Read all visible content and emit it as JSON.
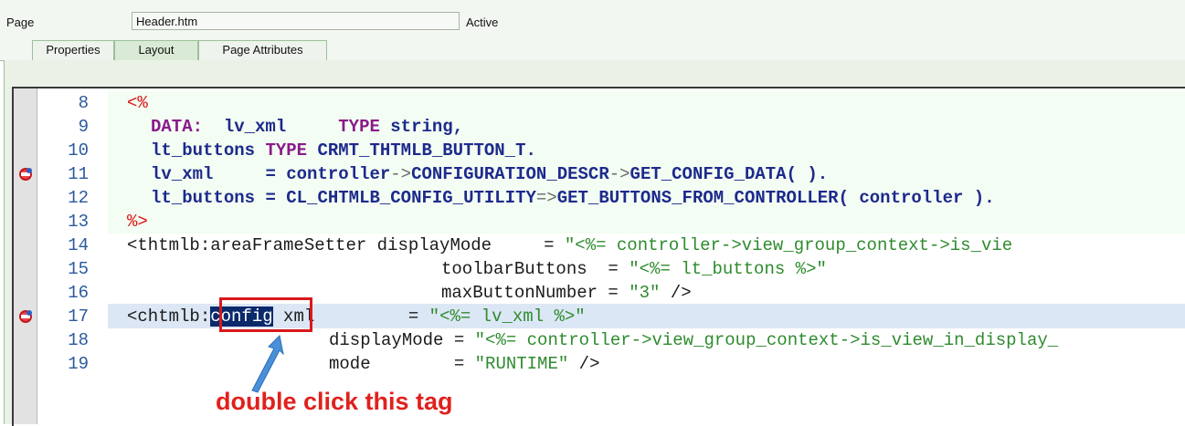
{
  "header": {
    "page_label": "Page",
    "page_value": "Header.htm",
    "status": "Active"
  },
  "tabs": [
    {
      "label": "Properties",
      "active": false
    },
    {
      "label": "Layout",
      "active": true
    },
    {
      "label": "Page Attributes",
      "active": false
    }
  ],
  "editor": {
    "lines": [
      {
        "num": "8"
      },
      {
        "num": "9"
      },
      {
        "num": "10"
      },
      {
        "num": "11",
        "breakpoint": true
      },
      {
        "num": "12"
      },
      {
        "num": "13"
      },
      {
        "num": "14"
      },
      {
        "num": "15"
      },
      {
        "num": "16"
      },
      {
        "num": "17",
        "breakpoint": true,
        "highlighted": true
      },
      {
        "num": "18"
      },
      {
        "num": "19"
      }
    ],
    "code": {
      "l8_open": "<%",
      "l9_data": "DATA:",
      "l9_var": "lv_xml",
      "l9_type": "TYPE",
      "l9_typename": "string,",
      "l10_var": "lt_buttons",
      "l10_type": "TYPE",
      "l10_typename": "CRMT_THTMLB_BUTTON_T.",
      "l11_var": "lv_xml",
      "l11_eq": "=",
      "l11_ctrl": "controller",
      "l11_arrow1": "->",
      "l11_attr": "CONFIGURATION_DESCR",
      "l11_arrow2": "->",
      "l11_method": "GET_CONFIG_DATA( ).",
      "l12_var": "lt_buttons",
      "l12_eq": "=",
      "l12_class": "CL_CHTMLB_CONFIG_UTILITY",
      "l12_arrow": "=>",
      "l12_method": "GET_BUTTONS_FROM_CONTROLLER( controller ).",
      "l13_close": "%>",
      "l14_tag": "<thtmlb:areaFrameSetter displayMode     = ",
      "l14_str": "\"<%= controller->view_group_context->is_vie",
      "l15_attr": "toolbarButtons  = ",
      "l15_str": "\"<%= lt_buttons %>\"",
      "l16_attr": "maxButtonNumber = ",
      "l16_str": "\"3\"",
      "l16_end": " />",
      "l17_tagpre": "<chtmlb:",
      "l17_sel": "config",
      "l17_attr": " xml         = ",
      "l17_str": "\"<%= lv_xml %>\"",
      "l18_attr": "displayMode = ",
      "l18_str": "\"<%= controller->view_group_context->is_view_in_display_",
      "l19_attr": "mode        = ",
      "l19_str": "\"RUNTIME\"",
      "l19_end": " />"
    }
  },
  "annotation": {
    "text": "double click this tag",
    "color": "#e0211d"
  }
}
